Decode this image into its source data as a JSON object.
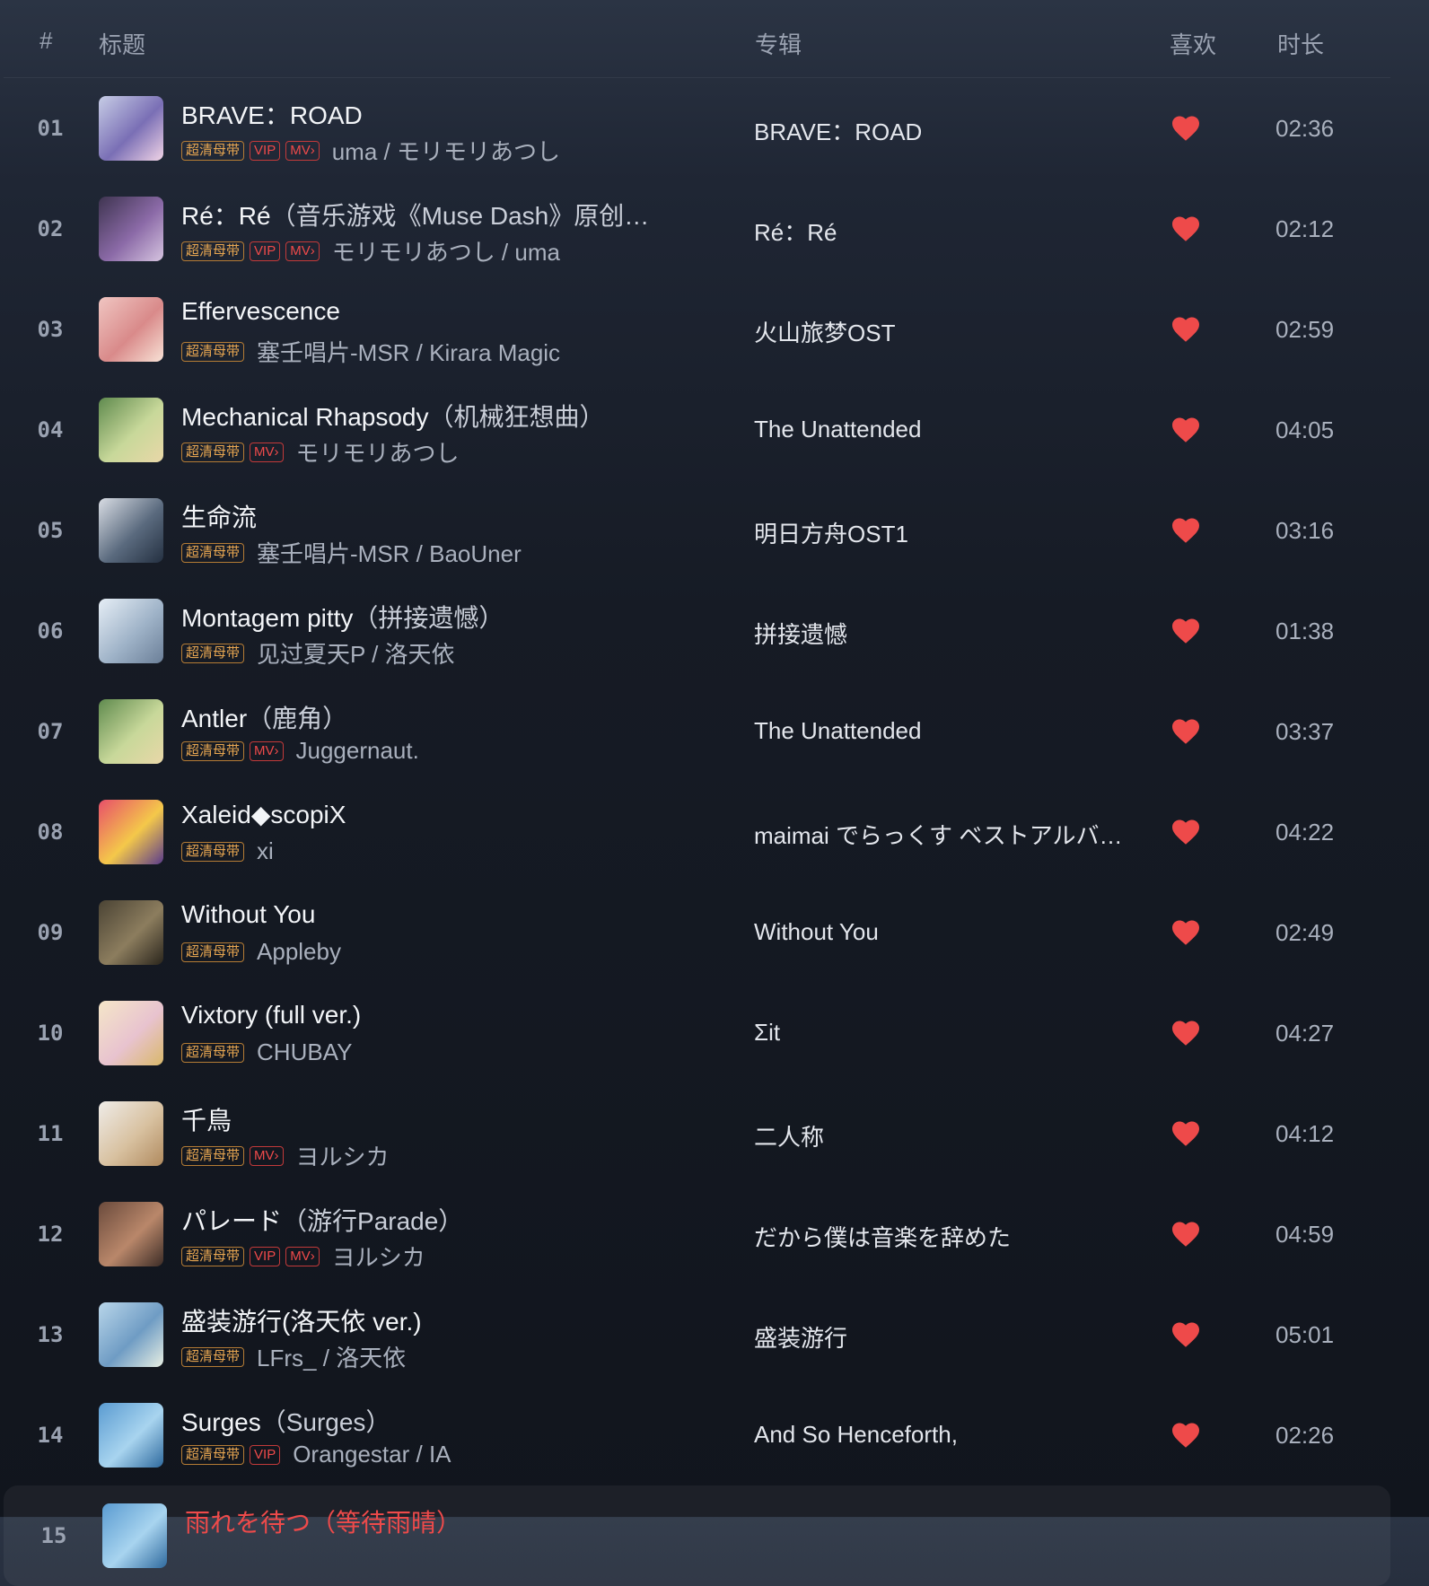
{
  "header": {
    "index": "#",
    "title": "标题",
    "album": "专辑",
    "like": "喜欢",
    "duration": "时长"
  },
  "colors": {
    "accent": "#ee4a4a",
    "hq_tag": "#e7a651"
  },
  "tracks": [
    {
      "index": "01",
      "title": "BRAVE：ROAD",
      "subtitle": "",
      "tags": [
        "超清母带",
        "VIP",
        "MV›"
      ],
      "artists": "uma / モリモリあつし",
      "album": "BRAVE：ROAD",
      "liked": true,
      "duration": "02:36",
      "cover": [
        "#c7cde6",
        "#7a6fb5",
        "#f1d4e6"
      ]
    },
    {
      "index": "02",
      "title": "Ré：Ré",
      "subtitle": "（音乐游戏《Muse Dash》原创…",
      "tags": [
        "超清母带",
        "VIP",
        "MV›"
      ],
      "artists": "モリモリあつし / uma",
      "album": "Ré：Ré",
      "liked": true,
      "duration": "02:12",
      "cover": [
        "#3e3450",
        "#8b6aa7",
        "#d6c4e0"
      ]
    },
    {
      "index": "03",
      "title": "Effervescence",
      "subtitle": "",
      "tags": [
        "超清母带"
      ],
      "artists": "塞壬唱片-MSR / Kirara Magic",
      "album": "火山旅梦OST",
      "liked": true,
      "duration": "02:59",
      "cover": [
        "#f0c6c2",
        "#d98a8a",
        "#f8e2d6"
      ]
    },
    {
      "index": "04",
      "title": "Mechanical Rhapsody",
      "subtitle": "（机械狂想曲）",
      "tags": [
        "超清母带",
        "MV›"
      ],
      "artists": "モリモリあつし",
      "album": "The Unattended",
      "liked": true,
      "duration": "04:05",
      "cover": [
        "#5f8a4e",
        "#c8d89a",
        "#e9d7a8"
      ]
    },
    {
      "index": "05",
      "title": "生命流",
      "subtitle": "",
      "tags": [
        "超清母带"
      ],
      "artists": "塞壬唱片-MSR / BaoUner",
      "album": "明日方舟OST1",
      "liked": true,
      "duration": "03:16",
      "cover": [
        "#d9dde4",
        "#5a6a7e",
        "#243041"
      ]
    },
    {
      "index": "06",
      "title": "Montagem pitty",
      "subtitle": "（拼接遗憾）",
      "tags": [
        "超清母带"
      ],
      "artists": "见过夏天P / 洛天依",
      "album": "拼接遗憾",
      "liked": true,
      "duration": "01:38",
      "cover": [
        "#e6eef6",
        "#9fb3c8",
        "#6b7f98"
      ]
    },
    {
      "index": "07",
      "title": "Antler",
      "subtitle": "（鹿角）",
      "tags": [
        "超清母带",
        "MV›"
      ],
      "artists": "Juggernaut.",
      "album": "The Unattended",
      "liked": true,
      "duration": "03:37",
      "cover": [
        "#5f8a4e",
        "#c8d89a",
        "#e9d7a8"
      ]
    },
    {
      "index": "08",
      "title": "Xaleid◆scopiX",
      "subtitle": "",
      "tags": [
        "超清母带"
      ],
      "artists": "xi",
      "album": "maimai でらっくす ベストアルバ…",
      "liked": true,
      "duration": "04:22",
      "cover": [
        "#e84f6a",
        "#f4c84a",
        "#5a3b8c"
      ]
    },
    {
      "index": "09",
      "title": "Without You",
      "subtitle": "",
      "tags": [
        "超清母带"
      ],
      "artists": "Appleby",
      "album": "Without You",
      "liked": true,
      "duration": "02:49",
      "cover": [
        "#4a4334",
        "#8c7d5e",
        "#2a251c"
      ]
    },
    {
      "index": "10",
      "title": "Vixtory (full ver.)",
      "subtitle": "",
      "tags": [
        "超清母带"
      ],
      "artists": "CHUBAY",
      "album": "Σit",
      "liked": true,
      "duration": "04:27",
      "cover": [
        "#f5e6c8",
        "#e8c3cf",
        "#d9b86a"
      ]
    },
    {
      "index": "11",
      "title": "千鳥",
      "subtitle": "",
      "tags": [
        "超清母带",
        "MV›"
      ],
      "artists": "ヨルシカ",
      "album": "二人称",
      "liked": true,
      "duration": "04:12",
      "cover": [
        "#efece8",
        "#d8c1a0",
        "#b08a5e"
      ]
    },
    {
      "index": "12",
      "title": "パレード",
      "subtitle": "（游行Parade）",
      "tags": [
        "超清母带",
        "VIP",
        "MV›"
      ],
      "artists": "ヨルシカ",
      "album": "だから僕は音楽を辞めた",
      "liked": true,
      "duration": "04:59",
      "cover": [
        "#6a4a3c",
        "#b9876a",
        "#3c2c26"
      ]
    },
    {
      "index": "13",
      "title": "盛装游行(洛天依 ver.)",
      "subtitle": "",
      "tags": [
        "超清母带"
      ],
      "artists": "LFrs_ / 洛天依",
      "album": "盛装游行",
      "liked": true,
      "duration": "05:01",
      "cover": [
        "#b9d6ea",
        "#6f9cc4",
        "#e8efe3"
      ]
    },
    {
      "index": "14",
      "title": "Surges",
      "subtitle": "（Surges）",
      "tags": [
        "超清母带",
        "VIP"
      ],
      "artists": "Orangestar / IA",
      "album": "And So Henceforth,",
      "liked": true,
      "duration": "02:26",
      "cover": [
        "#5a9bd1",
        "#a8d4ef",
        "#2f6a9e"
      ]
    },
    {
      "index": "15",
      "title": "雨れを待つ",
      "subtitle": "（等待雨晴）",
      "tags": [],
      "artists": "",
      "album": "",
      "liked": false,
      "duration": "",
      "current": true,
      "cover": [
        "#5a9bd1",
        "#a8d4ef",
        "#2f6a9e"
      ]
    }
  ]
}
